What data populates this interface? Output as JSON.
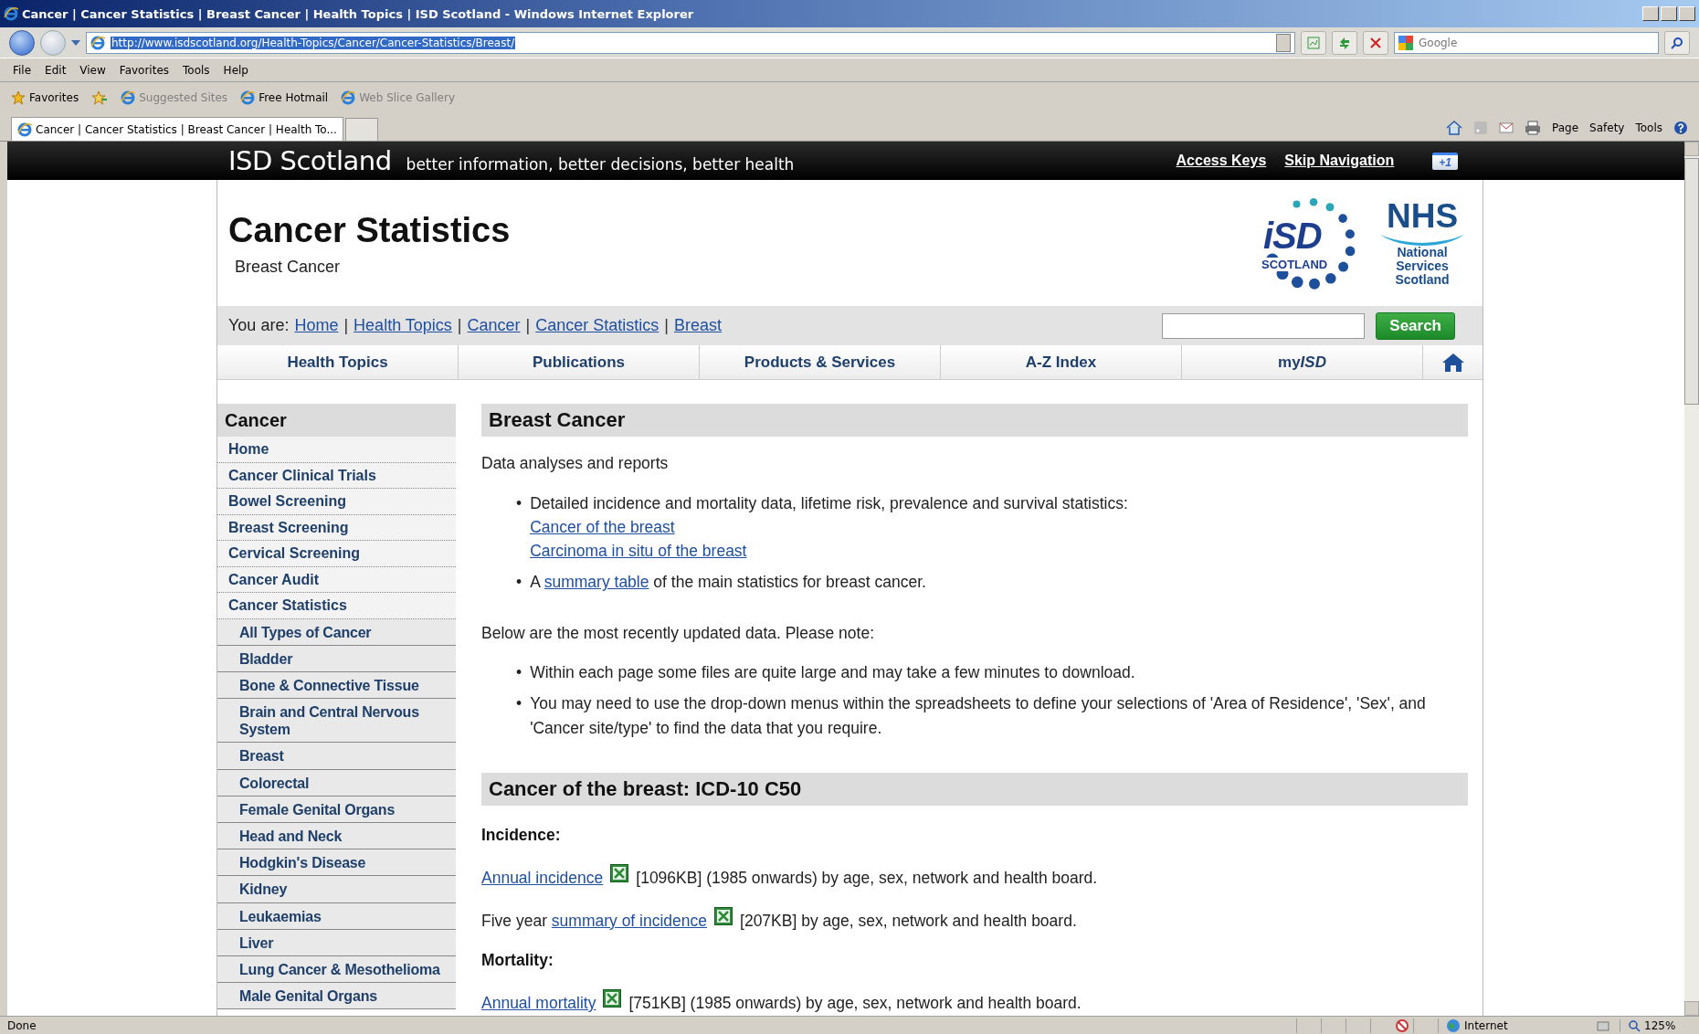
{
  "browser": {
    "title": "Cancer | Cancer Statistics | Breast Cancer | Health Topics | ISD Scotland - Windows Internet Explorer",
    "address": "http://www.isdscotland.org/Health-Topics/Cancer/Cancer-Statistics/Breast/",
    "search_placeholder": "Google",
    "menu": [
      "File",
      "Edit",
      "View",
      "Favorites",
      "Tools",
      "Help"
    ],
    "favorites_label": "Favorites",
    "favorites": [
      {
        "label": "Suggested Sites",
        "dimmed": true
      },
      {
        "label": "Free Hotmail",
        "dimmed": false
      },
      {
        "label": "Web Slice Gallery",
        "dimmed": true
      }
    ],
    "tab": "Cancer | Cancer Statistics | Breast Cancer | Health To...",
    "commands": [
      "Page",
      "Safety",
      "Tools"
    ],
    "status": "Done",
    "zone": "Internet",
    "zoom": "125%"
  },
  "site_header": {
    "brand": "ISD Scotland",
    "tagline": "better information, better decisions, better health",
    "links": [
      "Access Keys",
      "Skip Navigation"
    ],
    "plus_one": "+1"
  },
  "page": {
    "title": "Cancer Statistics",
    "subtitle": "Breast Cancer",
    "logos": {
      "isd": "iSD",
      "isd_sub": "SCOTLAND",
      "nhs": "NHS",
      "nhs_sub": [
        "National",
        "Services",
        "Scotland"
      ]
    },
    "breadcrumb": {
      "label": "You are:",
      "separator": "|",
      "crumbs": [
        "Home",
        "Health Topics",
        "Cancer",
        "Cancer Statistics",
        "Breast"
      ]
    },
    "search_button": "Search",
    "nav": [
      {
        "text": "Health Topics"
      },
      {
        "text": "Publications"
      },
      {
        "text": "Products & Services"
      },
      {
        "text": "A-Z Index"
      },
      {
        "text": "my",
        "em": "ISD"
      }
    ]
  },
  "sidebar": {
    "heading": "Cancer",
    "items": [
      {
        "label": "Home"
      },
      {
        "label": "Cancer Clinical Trials"
      },
      {
        "label": "Bowel Screening"
      },
      {
        "label": "Breast Screening"
      },
      {
        "label": "Cervical Screening"
      },
      {
        "label": "Cancer Audit"
      },
      {
        "label": "Cancer Statistics",
        "children": [
          {
            "label": "All Types of Cancer"
          },
          {
            "label": "Bladder"
          },
          {
            "label": "Bone & Connective Tissue"
          },
          {
            "label": "Brain and Central Nervous System"
          },
          {
            "label": "Breast"
          },
          {
            "label": "Colorectal"
          },
          {
            "label": "Female Genital Organs"
          },
          {
            "label": "Head and Neck"
          },
          {
            "label": "Hodgkin's Disease"
          },
          {
            "label": "Kidney"
          },
          {
            "label": "Leukaemias"
          },
          {
            "label": "Liver"
          },
          {
            "label": "Lung Cancer & Mesothelioma"
          },
          {
            "label": "Male Genital Organs"
          }
        ]
      }
    ]
  },
  "sections": [
    {
      "heading": "Breast Cancer",
      "blocks": [
        {
          "kind": "paragraph",
          "parts": [
            {
              "text": "Data analyses and reports",
              "link": false
            }
          ]
        },
        {
          "kind": "bullets",
          "marker": "•",
          "items": [
            {
              "parts": [
                {
                  "text": "Detailed incidence and mortality data, lifetime risk, prevalence and survival statistics:",
                  "link": false
                }
              ],
              "sublinks": [
                "Cancer of the breast",
                "Carcinoma in situ of the breast"
              ]
            },
            {
              "parts": [
                {
                  "text": "A ",
                  "link": false
                },
                {
                  "text": "summary table",
                  "link": true
                },
                {
                  "text": " of the main statistics for breast cancer.",
                  "link": false
                }
              ]
            }
          ]
        },
        {
          "kind": "paragraph",
          "parts": [
            {
              "text": "Below are the most recently updated data. Please note:",
              "link": false
            }
          ]
        },
        {
          "kind": "bullets",
          "marker": "•",
          "items": [
            {
              "parts": [
                {
                  "text": "Within each page some files are quite large and may take a few minutes to download.",
                  "link": false
                }
              ]
            },
            {
              "parts": [
                {
                  "text": "You may need to use the drop-down menus within the spreadsheets to define your selections of 'Area of Residence', 'Sex', and 'Cancer site/type' to find the data that you require.",
                  "link": false
                }
              ]
            }
          ]
        }
      ]
    },
    {
      "heading": "Cancer of the breast: ICD-10 C50",
      "blocks": [
        {
          "kind": "subheading",
          "text": "Incidence:"
        },
        {
          "kind": "file",
          "link": "Annual incidence",
          "details": "[1096KB] (1985 onwards) by age, sex, network and health board."
        },
        {
          "kind": "file",
          "prefix": "Five year ",
          "link": "summary of incidence",
          "details": "[207KB] by age, sex, network and health board."
        },
        {
          "kind": "subheading",
          "text": "Mortality:"
        },
        {
          "kind": "file",
          "link": "Annual mortality",
          "details": "[751KB] (1985 onwards) by age, sex, network and health board."
        }
      ]
    }
  ]
}
